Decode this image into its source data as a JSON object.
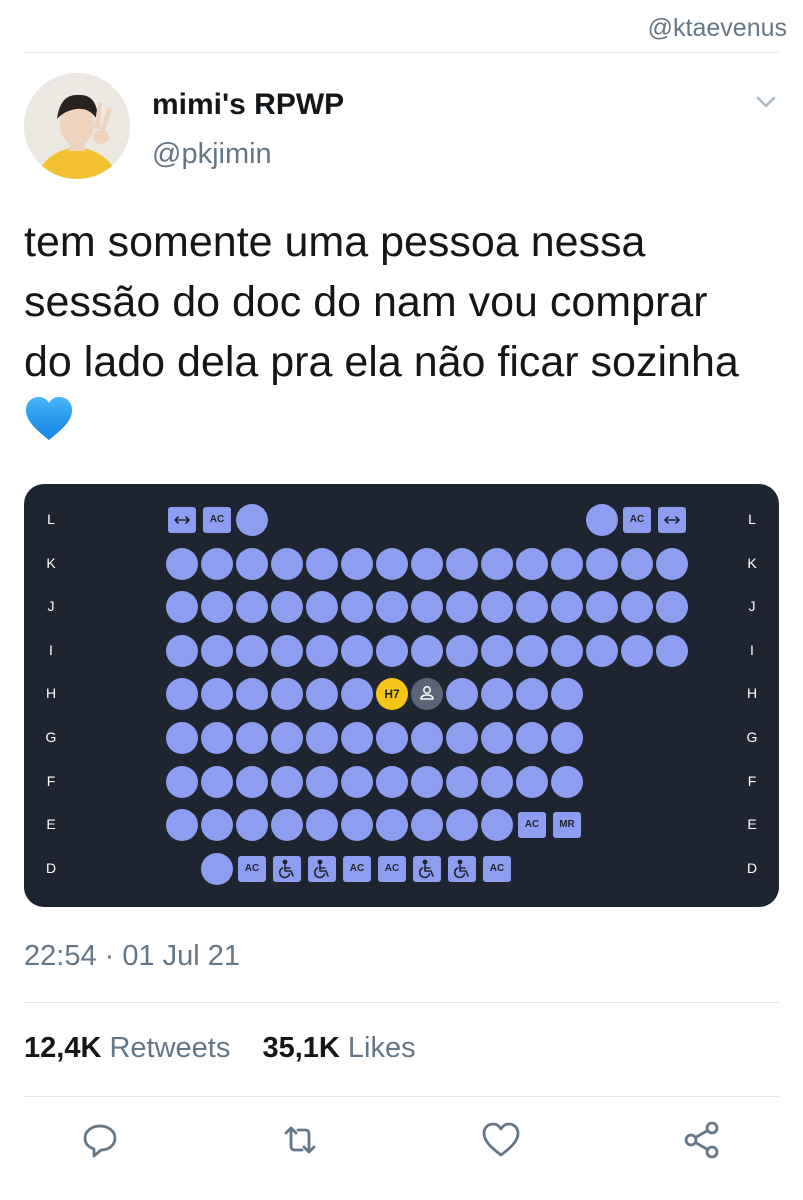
{
  "watermark": "@ktaevenus",
  "tweet": {
    "display_name": "mimi's RPWP",
    "handle": "@pkjimin",
    "text": "tem somente uma pessoa nessa sessão do doc do nam vou comprar do lado dela pra ela não ficar sozinha",
    "emoji": "blue-heart-emoji",
    "timestamp": "22:54 · 01 Jul 21",
    "retweets_count": "12,4K",
    "retweets_label": "Retweets",
    "likes_count": "35,1K",
    "likes_label": "Likes"
  },
  "seatmap": {
    "rows_left": [
      "L",
      "K",
      "J",
      "I",
      "H",
      "G",
      "F",
      "E",
      "D"
    ],
    "rows_right": [
      "L",
      "K",
      "J",
      "I",
      "H",
      "G",
      "F",
      "E",
      "D"
    ],
    "selected_seat": "H7",
    "ac_label": "AC",
    "mr_label": "MR",
    "colors": {
      "background": "#1f2530",
      "available": "#8d9ef0",
      "selected": "#f5c518",
      "occupied": "#5b6577"
    }
  },
  "icons": {
    "menu": "chevron-down-icon",
    "reply": "reply-icon",
    "retweet": "retweet-icon",
    "like": "heart-icon",
    "share": "share-icon"
  }
}
